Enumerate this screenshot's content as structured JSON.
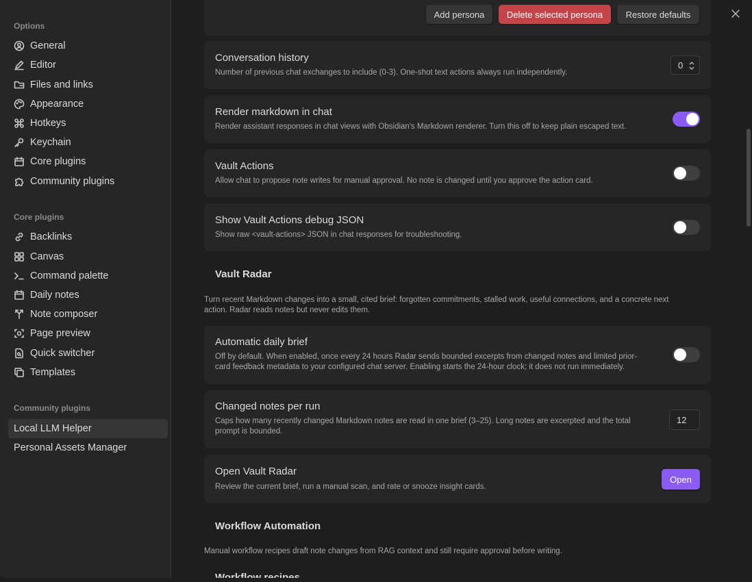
{
  "sidebar": {
    "options_header": "Options",
    "options": [
      {
        "label": "General",
        "icon": "user-circle-icon"
      },
      {
        "label": "Editor",
        "icon": "pencil-icon"
      },
      {
        "label": "Files and links",
        "icon": "folder-icon"
      },
      {
        "label": "Appearance",
        "icon": "palette-icon"
      },
      {
        "label": "Hotkeys",
        "icon": "command-icon"
      },
      {
        "label": "Keychain",
        "icon": "key-icon"
      },
      {
        "label": "Core plugins",
        "icon": "calendar-box-icon"
      },
      {
        "label": "Community plugins",
        "icon": "puzzle-icon"
      }
    ],
    "core_header": "Core plugins",
    "core": [
      {
        "label": "Backlinks",
        "icon": "link-icon"
      },
      {
        "label": "Canvas",
        "icon": "grid-icon"
      },
      {
        "label": "Command palette",
        "icon": "terminal-icon"
      },
      {
        "label": "Daily notes",
        "icon": "calendar-icon"
      },
      {
        "label": "Note composer",
        "icon": "merge-icon"
      },
      {
        "label": "Page preview",
        "icon": "eye-icon"
      },
      {
        "label": "Quick switcher",
        "icon": "file-search-icon"
      },
      {
        "label": "Templates",
        "icon": "copy-icon"
      }
    ],
    "community_header": "Community plugins",
    "community": [
      {
        "label": "Local LLM Helper"
      },
      {
        "label": "Personal Assets Manager"
      }
    ]
  },
  "persona": {
    "add_label": "Add persona",
    "delete_label": "Delete selected persona",
    "restore_label": "Restore defaults"
  },
  "settings": {
    "history": {
      "title": "Conversation history",
      "desc": "Number of previous chat exchanges to include (0-3). One-shot text actions always run independently.",
      "value": "0"
    },
    "markdown": {
      "title": "Render markdown in chat",
      "desc": "Render assistant responses in chat views with Obsidian's Markdown renderer. Turn this off to keep plain escaped text.",
      "enabled": true
    },
    "vault_actions": {
      "title": "Vault Actions",
      "desc": "Allow chat to propose note writes for manual approval. No note is changed until you approve the action card.",
      "enabled": false
    },
    "debug_json": {
      "title": "Show Vault Actions debug JSON",
      "desc": "Show raw <vault-actions> JSON in chat responses for troubleshooting.",
      "enabled": false
    }
  },
  "radar": {
    "heading": "Vault Radar",
    "intro_1": "Turn recent Markdown changes into a small, cited brief: forgotten commitments, stalled work, useful connections, and a concrete next",
    "intro_2": "action. Radar reads notes but never edits them.",
    "daily": {
      "title": "Automatic daily brief",
      "desc_1": "Off by default. When enabled, once every 24 hours Radar sends bounded excerpts from changed notes and limited prior-",
      "desc_2": "card feedback metadata to your configured chat server. Enabling starts the 24-hour clock; it does not run immediately.",
      "enabled": false
    },
    "changed": {
      "title": "Changed notes per run",
      "desc_1": "Caps how many recently changed Markdown notes are read in one brief (3–25). Long notes are excerpted and the total",
      "desc_2": "prompt is bounded.",
      "value": "12"
    },
    "open": {
      "title": "Open Vault Radar",
      "desc": "Review the current brief, run a manual scan, and rate or snooze insight cards.",
      "button": "Open"
    }
  },
  "workflow": {
    "heading": "Workflow Automation",
    "intro": "Manual workflow recipes draft note changes from RAG context and still require approval before writing.",
    "next_heading": "Workflow recipes"
  },
  "colors": {
    "accent": "#8a5cf5",
    "danger": "#c4444a"
  }
}
